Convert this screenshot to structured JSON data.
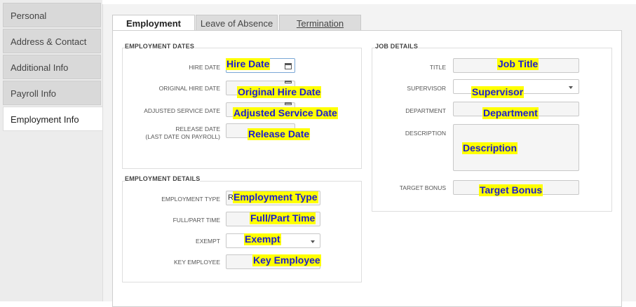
{
  "sidebar": {
    "items": [
      {
        "label": "Personal"
      },
      {
        "label": "Address & Contact"
      },
      {
        "label": "Additional Info"
      },
      {
        "label": "Payroll Info"
      },
      {
        "label": "Employment Info"
      }
    ]
  },
  "tabs": [
    {
      "label": "Employment"
    },
    {
      "label": "Leave of Absence"
    },
    {
      "label": "Termination"
    }
  ],
  "employment_dates": {
    "title": "EMPLOYMENT DATES",
    "hire_date_label": "HIRE DATE",
    "hire_date_value": "Hire Date",
    "original_hire_label": "ORIGINAL HIRE DATE",
    "original_hire_value": "Original Hire Date",
    "adjusted_service_label": "ADJUSTED SERVICE DATE",
    "adjusted_service_value": "Adjusted Service Date",
    "release_label_1": "RELEASE DATE",
    "release_label_2": "(LAST DATE ON PAYROLL)",
    "release_value": "Release Date"
  },
  "employment_details": {
    "title": "EMPLOYMENT DETAILS",
    "type_label": "EMPLOYMENT TYPE",
    "type_prefix": "R",
    "type_value": "Employment Type",
    "fullpart_label": "FULL/PART TIME",
    "fullpart_value": "Full/Part Time",
    "exempt_label": "EXEMPT",
    "exempt_value": "Exempt",
    "key_label": "KEY EMPLOYEE",
    "key_value": "Key Employee"
  },
  "job_details": {
    "title": "JOB DETAILS",
    "title_label": "TITLE",
    "title_value": "Job Title",
    "supervisor_label": "SUPERVISOR",
    "supervisor_value": "Supervisor",
    "department_label": "DEPARTMENT",
    "department_value": "Department",
    "description_label": "DESCRIPTION",
    "description_value": "Description",
    "bonus_label": "TARGET BONUS",
    "bonus_value": "Target Bonus"
  },
  "colors": {
    "highlight": "#ffff00",
    "highlight_text": "#1b1bd1"
  }
}
